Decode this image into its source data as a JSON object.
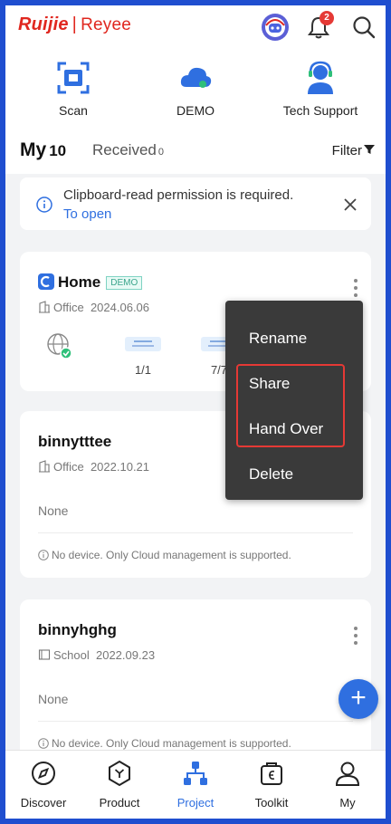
{
  "header": {
    "brand_primary": "Ruijie",
    "brand_separator": "|",
    "brand_secondary": "Reyee",
    "notification_count": "2"
  },
  "quick_actions": [
    {
      "label": "Scan",
      "icon": "scan-icon"
    },
    {
      "label": "DEMO",
      "icon": "cloud-icon"
    },
    {
      "label": "Tech Support",
      "icon": "support-agent-icon"
    }
  ],
  "tabs": {
    "my_label": "My",
    "my_count": "10",
    "received_label": "Received",
    "received_count": "0",
    "filter_label": "Filter"
  },
  "banner": {
    "message": "Clipboard-read permission is required.",
    "link": "To open"
  },
  "projects": [
    {
      "name": "Home",
      "tag": "DEMO",
      "type": "Office",
      "date": "2024.06.06",
      "devices": [
        {
          "icon": "internet-globe-icon",
          "value": ""
        },
        {
          "icon": "switch-device-icon",
          "value": "1/1"
        },
        {
          "icon": "switch-sw-icon",
          "value": "7/7"
        }
      ]
    },
    {
      "name": "binnytttee",
      "type": "Office",
      "date": "2022.10.21",
      "devices_text": "None",
      "note": "No device. Only Cloud management is supported."
    },
    {
      "name": "binnyhghg",
      "type": "School",
      "date": "2022.09.23",
      "devices_text": "None",
      "note": "No device. Only Cloud management is supported."
    }
  ],
  "context_menu": {
    "items": [
      "Rename",
      "Share",
      "Hand Over",
      "Delete"
    ],
    "highlight_color": "#e53935"
  },
  "fab_label": "+",
  "bottom_nav": [
    {
      "label": "Discover",
      "icon": "compass-icon"
    },
    {
      "label": "Product",
      "icon": "product-hex-icon"
    },
    {
      "label": "Project",
      "icon": "project-tree-icon",
      "active": true
    },
    {
      "label": "Toolkit",
      "icon": "toolkit-bag-icon"
    },
    {
      "label": "My",
      "icon": "person-icon"
    }
  ],
  "colors": {
    "accent": "#2f6fe0",
    "brand_red": "#e0271f",
    "frame": "#1f4ecf"
  }
}
